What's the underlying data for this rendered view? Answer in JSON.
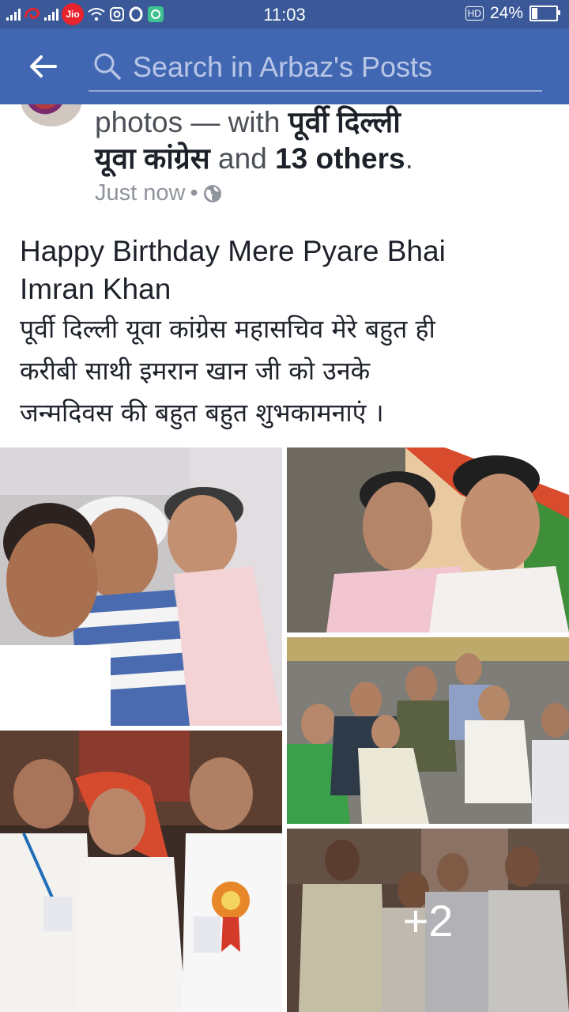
{
  "status_bar": {
    "carrier_badge": "Jio",
    "time": "11:03",
    "hd_label": "HD",
    "battery": "24%",
    "battery_level": 0.24
  },
  "search": {
    "placeholder": "Search in Arbaz's Posts"
  },
  "post": {
    "header_fragment": "photos",
    "header_with": " — with ",
    "tagged_page": "पूर्वी दिल्ली",
    "tagged_page_line2": "यूवा कांग्रेस",
    "and_text": " and ",
    "others": "13 others",
    "period": ".",
    "timestamp": "Just now",
    "dot": "•",
    "privacy_icon": "globe-icon",
    "text_en_line1": "Happy Birthday Mere Pyare Bhai",
    "text_en_line2": "Imran Khan",
    "text_hi_line1": "पूर्वी दिल्ली यूवा कांग्रेस महासचिव मेरे बहुत ही",
    "text_hi_line2": "करीबी साथी इमरान खान जी को उनके",
    "text_hi_line3": "जन्मदिवस की बहुत बहुत शुभकामनाएं ।",
    "more_photos": "+2"
  },
  "colors": {
    "status_bar": "#3b5998",
    "header": "#4267b2",
    "text": "#1d2129",
    "secondary": "#90949c"
  }
}
